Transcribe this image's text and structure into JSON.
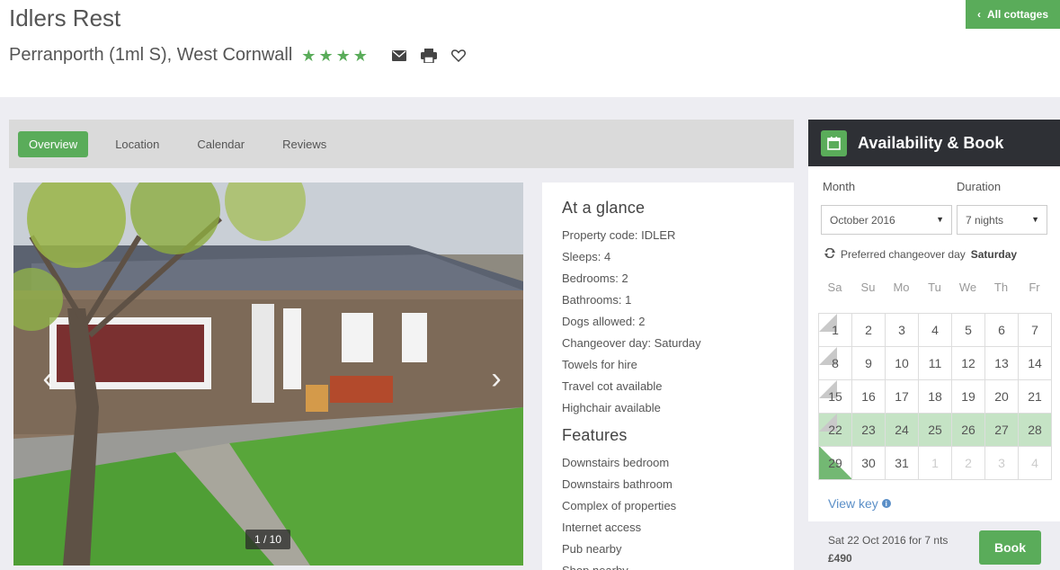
{
  "header": {
    "title": "Idlers Rest",
    "subtitle": "Perranporth (1ml S), West Cornwall",
    "star_count": 4,
    "all_cottages_label": "All cottages",
    "icons": [
      "envelope-icon",
      "printer-icon",
      "heart-icon"
    ]
  },
  "tabs": [
    {
      "label": "Overview",
      "active": true
    },
    {
      "label": "Location",
      "active": false
    },
    {
      "label": "Calendar",
      "active": false
    },
    {
      "label": "Reviews",
      "active": false
    }
  ],
  "gallery": {
    "counter": "1 / 10"
  },
  "glance": {
    "heading": "At a glance",
    "items": [
      "Property code: IDLER",
      "Sleeps: 4",
      "Bedrooms: 2",
      "Bathrooms: 1",
      "Dogs allowed: 2",
      "Changeover day: Saturday",
      "Towels for hire",
      "Travel cot available",
      "Highchair available"
    ],
    "features_heading": "Features",
    "features": [
      "Downstairs bedroom",
      "Downstairs bathroom",
      "Complex of properties",
      "Internet access",
      "Pub nearby",
      "Shop nearby"
    ]
  },
  "booking": {
    "title": "Availability & Book",
    "month_label": "Month",
    "month_value": "October 2016",
    "duration_label": "Duration",
    "duration_value": "7 nights",
    "changeover_text": "Preferred changeover day",
    "changeover_day": "Saturday",
    "weekdays": [
      "Sa",
      "Su",
      "Mo",
      "Tu",
      "We",
      "Th",
      "Fr"
    ],
    "weeks": [
      [
        "1",
        "2",
        "3",
        "4",
        "5",
        "6",
        "7"
      ],
      [
        "8",
        "9",
        "10",
        "11",
        "12",
        "13",
        "14"
      ],
      [
        "15",
        "16",
        "17",
        "18",
        "19",
        "20",
        "21"
      ],
      [
        "22",
        "23",
        "24",
        "25",
        "26",
        "27",
        "28"
      ],
      [
        "29",
        "30",
        "31",
        "1",
        "2",
        "3",
        "4"
      ]
    ],
    "view_key_label": "View key",
    "summary": "Sat 22 Oct 2016 for 7 nts",
    "price": "£490",
    "book_label": "Book"
  },
  "colors": {
    "accent": "#5aac5a",
    "dark_header": "#2e3035",
    "selected_day": "#c5e3c5",
    "link": "#5b8fc7"
  }
}
